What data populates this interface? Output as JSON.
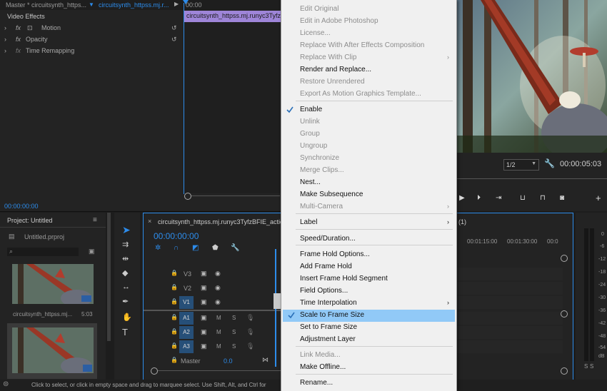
{
  "effect_controls": {
    "tab_master": "Master * circuitsynth_https...",
    "tab_clip": "circuitsynth_httpss.mj.r...",
    "timecode_start": "00:00",
    "section": "Video Effects",
    "effects": [
      "Motion",
      "Opacity",
      "Time Remapping"
    ],
    "clip_bar_label": "circuitsynth_httpss.mj.runyc3TyfzB",
    "timecode": "00:00:00:00"
  },
  "program_monitor": {
    "zoom": "1/2",
    "timecode": "00:00:05:03"
  },
  "project": {
    "title": "Project: Untitled",
    "file": "Untitled.prproj",
    "clip_name": "circuitsynth_httpss.mj...",
    "clip_duration": "5:03"
  },
  "timeline": {
    "sequence_tab": "circuitsynth_httpss.mj.runyc3TyfzBFIE_action_...",
    "tab_suffix": "(1)",
    "timecode": "00:00:00:00",
    "ruler": [
      "00:01:15:00",
      "00:01:30:00",
      "00:0"
    ],
    "video_tracks": [
      "V3",
      "V2",
      "V1"
    ],
    "audio_tracks": [
      "A1",
      "A2",
      "A3"
    ],
    "master_label": "Master",
    "master_value": "0.0",
    "mute_label": "M",
    "solo_label": "S"
  },
  "audio_meter": {
    "db_labels": [
      "0",
      "-6",
      "-12",
      "-18",
      "-24",
      "-30",
      "-36",
      "-42",
      "-48",
      "-54",
      "dB"
    ],
    "solo_buttons": [
      "S",
      "S"
    ]
  },
  "status_bar": {
    "text": "Click to select, or click in empty space and drag to marquee select. Use Shift, Alt, and Ctrl for"
  },
  "context_menu": {
    "items": [
      {
        "label": "Edit Original",
        "enabled": false
      },
      {
        "label": "Edit in Adobe Photoshop",
        "enabled": false
      },
      {
        "label": "License...",
        "enabled": false
      },
      {
        "label": "Replace With After Effects Composition",
        "enabled": false
      },
      {
        "label": "Replace With Clip",
        "enabled": false,
        "submenu": true
      },
      {
        "label": "Render and Replace...",
        "enabled": true
      },
      {
        "label": "Restore Unrendered",
        "enabled": false
      },
      {
        "label": "Export As Motion Graphics Template...",
        "enabled": false
      },
      {
        "label": "Enable",
        "enabled": true,
        "checked": true
      },
      {
        "label": "Unlink",
        "enabled": false
      },
      {
        "label": "Group",
        "enabled": false
      },
      {
        "label": "Ungroup",
        "enabled": false
      },
      {
        "label": "Synchronize",
        "enabled": false
      },
      {
        "label": "Merge Clips...",
        "enabled": false
      },
      {
        "label": "Nest...",
        "enabled": true
      },
      {
        "label": "Make Subsequence",
        "enabled": true
      },
      {
        "label": "Multi-Camera",
        "enabled": false,
        "submenu": true
      },
      {
        "label": "Label",
        "enabled": true,
        "submenu": true
      },
      {
        "label": "Speed/Duration...",
        "enabled": true
      },
      {
        "label": "Frame Hold Options...",
        "enabled": true
      },
      {
        "label": "Add Frame Hold",
        "enabled": true
      },
      {
        "label": "Insert Frame Hold Segment",
        "enabled": true
      },
      {
        "label": "Field Options...",
        "enabled": true
      },
      {
        "label": "Time Interpolation",
        "enabled": true,
        "submenu": true
      },
      {
        "label": "Scale to Frame Size",
        "enabled": true,
        "checked": true,
        "highlighted": true
      },
      {
        "label": "Set to Frame Size",
        "enabled": true
      },
      {
        "label": "Adjustment Layer",
        "enabled": true
      },
      {
        "label": "Link Media...",
        "enabled": false
      },
      {
        "label": "Make Offline...",
        "enabled": true
      },
      {
        "label": "Rename...",
        "enabled": true
      }
    ]
  }
}
